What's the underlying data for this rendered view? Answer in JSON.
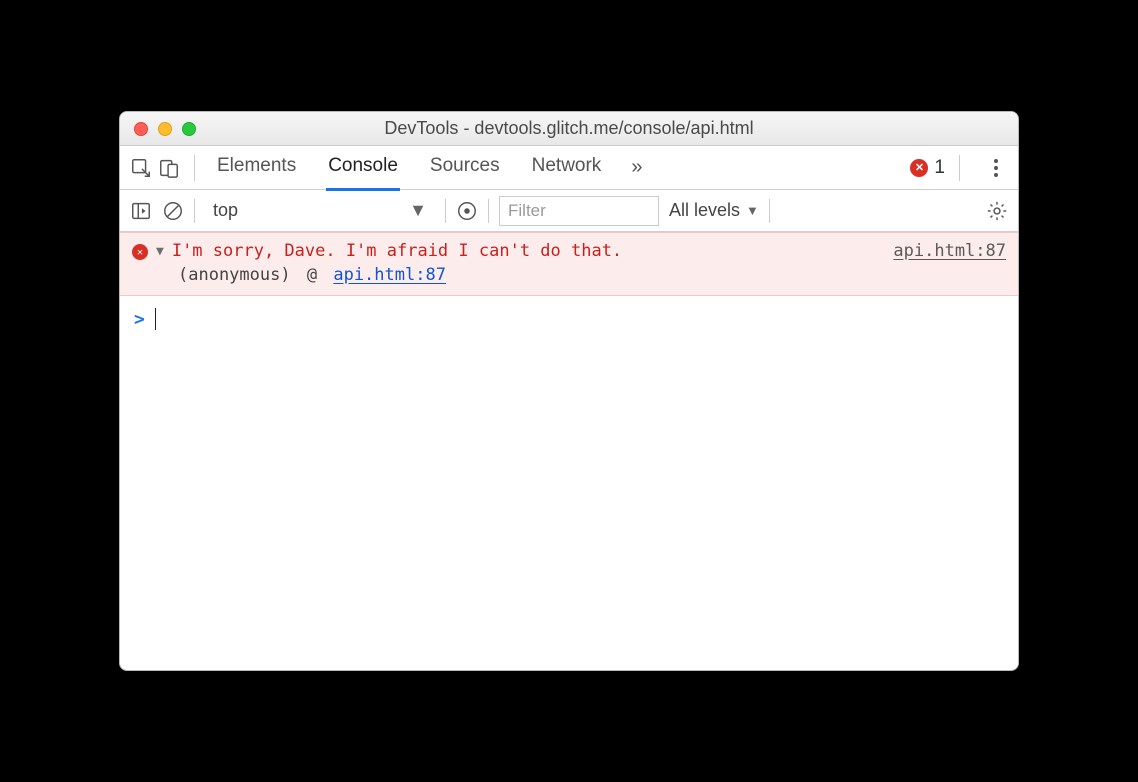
{
  "window": {
    "title": "DevTools - devtools.glitch.me/console/api.html"
  },
  "mainbar": {
    "tabs": [
      "Elements",
      "Console",
      "Sources",
      "Network"
    ],
    "active_tab_index": 1,
    "more_glyph": "»",
    "error_count": "1"
  },
  "subbar": {
    "context": "top",
    "filter_placeholder": "Filter",
    "levels_label": "All levels"
  },
  "console": {
    "error": {
      "message": "I'm sorry, Dave. I'm afraid I can't do that.",
      "source": "api.html:87",
      "stack_label": "(anonymous)",
      "stack_at": "@",
      "stack_link": "api.html:87"
    },
    "prompt_glyph": ">"
  }
}
